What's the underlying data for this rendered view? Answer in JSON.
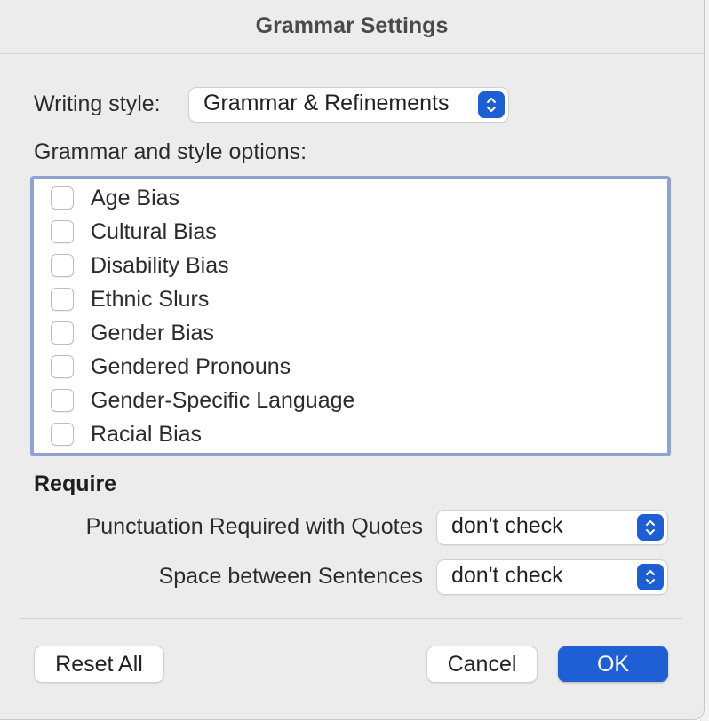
{
  "dialog": {
    "title": "Grammar Settings"
  },
  "writing_style": {
    "label": "Writing style:",
    "value": "Grammar & Refinements",
    "stepper_icon": "up-down-chevron-icon"
  },
  "options": {
    "label": "Grammar and style options:",
    "items": [
      {
        "label": "Age Bias",
        "checked": false
      },
      {
        "label": "Cultural Bias",
        "checked": false
      },
      {
        "label": "Disability Bias",
        "checked": false
      },
      {
        "label": "Ethnic Slurs",
        "checked": false
      },
      {
        "label": "Gender Bias",
        "checked": false
      },
      {
        "label": "Gendered Pronouns",
        "checked": false
      },
      {
        "label": "Gender-Specific Language",
        "checked": false
      },
      {
        "label": "Racial Bias",
        "checked": false
      }
    ]
  },
  "require": {
    "heading": "Require",
    "punctuation": {
      "label": "Punctuation Required with Quotes",
      "value": "don't check"
    },
    "spacing": {
      "label": "Space between Sentences",
      "value": "don't check"
    }
  },
  "buttons": {
    "reset": "Reset All",
    "cancel": "Cancel",
    "ok": "OK"
  },
  "colors": {
    "accent": "#1f5fd4",
    "list_border": "#8ea3cf",
    "dialog_bg": "#ececec"
  }
}
